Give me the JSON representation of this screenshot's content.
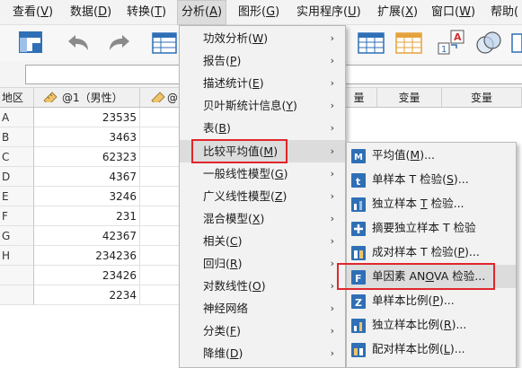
{
  "menubar": {
    "items": [
      {
        "label": "查看(",
        "key": "V",
        "suffix": ")"
      },
      {
        "label": "数据(",
        "key": "D",
        "suffix": ")"
      },
      {
        "label": "转换(",
        "key": "T",
        "suffix": ")"
      },
      {
        "label": "分析(",
        "key": "A",
        "suffix": ")"
      },
      {
        "label": "图形(",
        "key": "G",
        "suffix": ")"
      },
      {
        "label": "实用程序(",
        "key": "U",
        "suffix": ")"
      },
      {
        "label": "扩展(",
        "key": "X",
        "suffix": ")"
      },
      {
        "label": "窗口(",
        "key": "W",
        "suffix": ")"
      },
      {
        "label": "帮助(",
        "key": "",
        "suffix": ""
      }
    ],
    "active_index": 3
  },
  "toolbar": {
    "icons": [
      "data-editor-icon",
      "undo-icon",
      "redo-icon",
      "goto-case-icon",
      "goto-variable-icon",
      "split-file-icon",
      "insert-variable-icon",
      "use-sets-icon"
    ],
    "badge_number": "1",
    "badge_letter": "A"
  },
  "grid": {
    "headers": [
      "地区",
      "@1（男性）",
      "@",
      "量",
      "变量",
      "变量"
    ],
    "row_labels": [
      "A",
      "B",
      "C",
      "D",
      "E",
      "F",
      "G",
      "H",
      "",
      ""
    ],
    "values": [
      "23535",
      "3463",
      "62323",
      "4367",
      "3246",
      "231",
      "42367",
      "234236",
      "23426",
      "2234"
    ]
  },
  "analyze_menu": {
    "items": [
      {
        "label": "功效分析(",
        "key": "W",
        "suffix": ")"
      },
      {
        "label": "报告(",
        "key": "P",
        "suffix": ")"
      },
      {
        "label": "描述统计(",
        "key": "E",
        "suffix": ")"
      },
      {
        "label": "贝叶斯统计信息(",
        "key": "Y",
        "suffix": ")"
      },
      {
        "label": "表(",
        "key": "B",
        "suffix": ")"
      },
      {
        "label": "比较平均值(",
        "key": "M",
        "suffix": ")"
      },
      {
        "label": "一般线性模型(",
        "key": "G",
        "suffix": ")"
      },
      {
        "label": "广义线性模型(",
        "key": "Z",
        "suffix": ")"
      },
      {
        "label": "混合模型(",
        "key": "X",
        "suffix": ")"
      },
      {
        "label": "相关(",
        "key": "C",
        "suffix": ")"
      },
      {
        "label": "回归(",
        "key": "R",
        "suffix": ")"
      },
      {
        "label": "对数线性(",
        "key": "O",
        "suffix": ")"
      },
      {
        "label": "神经网络",
        "key": "",
        "suffix": ""
      },
      {
        "label": "分类(",
        "key": "F",
        "suffix": ")"
      },
      {
        "label": "降维(",
        "key": "D",
        "suffix": ")"
      }
    ],
    "highlighted_index": 5,
    "arrow": "›"
  },
  "compare_means_menu": {
    "items": [
      {
        "icon": "means-icon",
        "label": "平均值(",
        "key": "M",
        "suffix": ")..."
      },
      {
        "icon": "one-sample-t-icon",
        "label": "单样本 T 检验(",
        "key": "S",
        "suffix": ")..."
      },
      {
        "icon": "independent-t-icon",
        "label": "独立样本 ",
        "key": "T",
        "suffix": " 检验..."
      },
      {
        "icon": "summary-t-icon",
        "label": "摘要独立样本 T 检验",
        "key": "",
        "suffix": ""
      },
      {
        "icon": "paired-t-icon",
        "label": "成对样本 T 检验(",
        "key": "P",
        "suffix": ")..."
      },
      {
        "icon": "one-way-anova-icon",
        "label": "单因素 AN",
        "key": "O",
        "suffix": "VA 检验..."
      },
      {
        "icon": "one-sample-proportion-icon",
        "label": "单样本比例(",
        "key": "P",
        "suffix": ")..."
      },
      {
        "icon": "independent-proportion-icon",
        "label": "独立样本比例(",
        "key": "R",
        "suffix": ")..."
      },
      {
        "icon": "paired-proportion-icon",
        "label": "配对样本比例(",
        "key": "L",
        "suffix": ")..."
      }
    ],
    "highlighted_index": 5
  },
  "colors": {
    "highlight_box": "#e0262b",
    "menu_bg": "#f2f2f2",
    "menu_highlight": "#dcdcdc",
    "icon_blue": "#2f6fb6"
  }
}
